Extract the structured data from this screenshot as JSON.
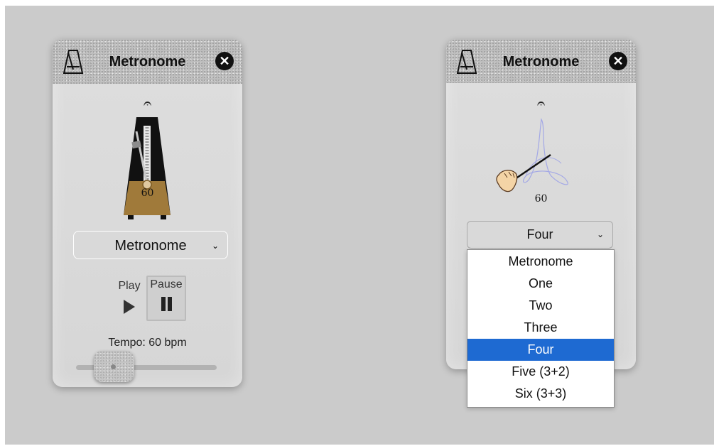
{
  "left_widget": {
    "title": "Metronome",
    "close_symbol": "✕",
    "fermata_symbol": "𝄐",
    "tempo_number": "60",
    "select": {
      "selected": "Metronome",
      "chevron": "⌄"
    },
    "play": {
      "label": "Play"
    },
    "pause": {
      "label": "Pause"
    },
    "tempo_label": "Tempo: 60 bpm",
    "slider": {
      "value": 60
    }
  },
  "right_widget": {
    "title": "Metronome",
    "close_symbol": "✕",
    "fermata_symbol": "𝄐",
    "tempo_number": "60",
    "select": {
      "selected": "Four",
      "chevron": "⌄"
    },
    "options": [
      "Metronome",
      "One",
      "Two",
      "Three",
      "Four",
      "Five (3+2)",
      "Six (3+3)"
    ]
  },
  "colors": {
    "background": "#cbcbcb",
    "panel": "#dadada",
    "selected_option": "#1e6ad2",
    "metronome_body": "#111111",
    "metronome_base": "#a07a3a"
  },
  "icons": [
    "metronome-icon",
    "close-icon",
    "fermata-icon",
    "play-icon",
    "pause-icon",
    "chevron-down-icon",
    "conductor-hand-icon"
  ]
}
